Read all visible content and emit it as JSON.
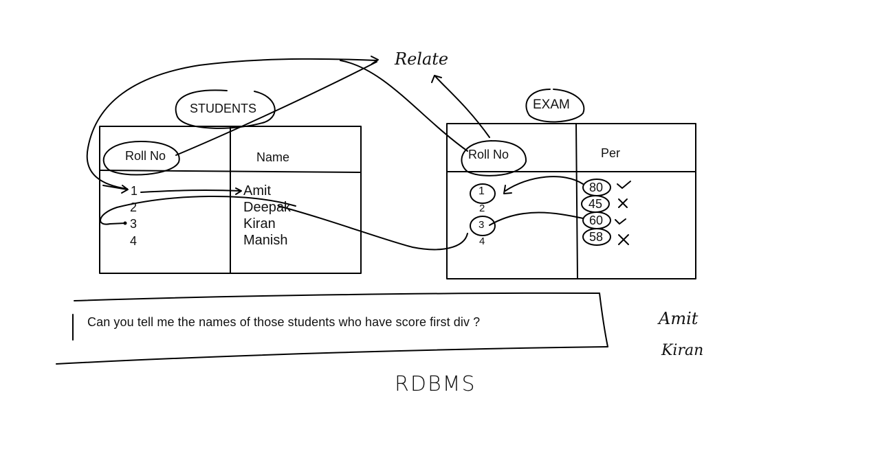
{
  "students": {
    "title": "STUDENTS",
    "columns": [
      "Roll No",
      "Name"
    ],
    "roll_numbers": [
      "1",
      "2",
      "3",
      "4"
    ],
    "names": [
      "Amit",
      "Deepak",
      "Kiran",
      "Manish"
    ]
  },
  "exam": {
    "title": "EXAM",
    "columns": [
      "Roll No",
      "Per"
    ],
    "roll_numbers": [
      "1",
      "2",
      "3",
      "4"
    ],
    "percentages": [
      "80",
      "45",
      "60",
      "58"
    ],
    "marks": [
      "✓",
      "✗",
      "✓",
      "✗"
    ]
  },
  "annotations": {
    "relate": "Relate",
    "question": "Can you tell me the names of those students who have score first div ?",
    "answers": [
      "Amit",
      "Kiran"
    ],
    "footer": "RDBMS"
  }
}
